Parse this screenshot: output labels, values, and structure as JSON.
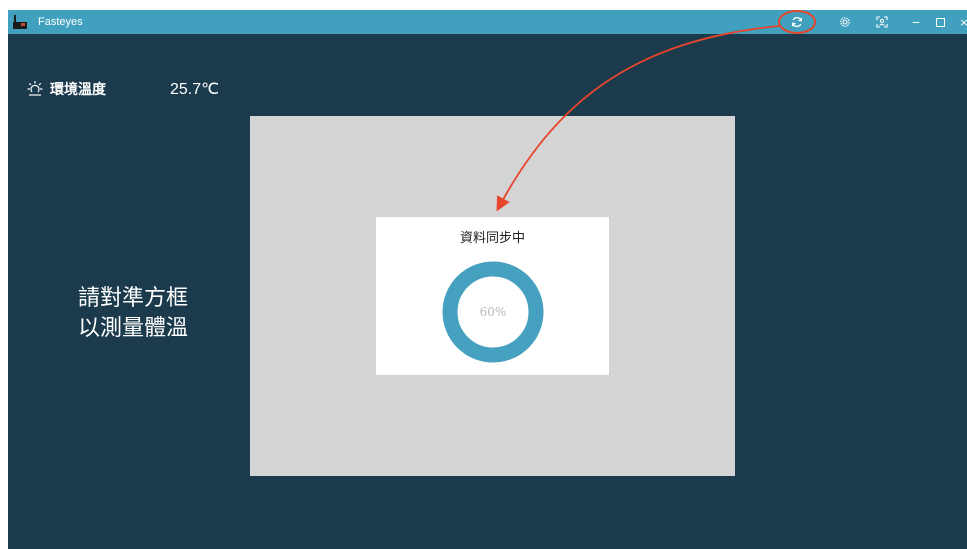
{
  "window": {
    "title": "Fasteyes",
    "icon": "camera-device-icon"
  },
  "titlebar_buttons": [
    {
      "name": "sync-button",
      "icon": "refresh-icon",
      "glyph": "⟳"
    },
    {
      "name": "settings-button",
      "icon": "gear-icon",
      "glyph": "⚙"
    },
    {
      "name": "face-frame-button",
      "icon": "face-frame-icon",
      "glyph": "⛶"
    },
    {
      "name": "minimize-button",
      "icon": "minimize-icon",
      "glyph": "−"
    },
    {
      "name": "maximize-button",
      "icon": "maximize-icon",
      "glyph": "□"
    },
    {
      "name": "close-button",
      "icon": "close-icon",
      "glyph": "×"
    }
  ],
  "environment": {
    "label": "環境溫度",
    "value": "25.7℃",
    "icon": "sun-icon"
  },
  "instruction": {
    "line1": "請對準方框",
    "line2": "以測量體溫"
  },
  "sync_dialog": {
    "title": "資料同步中",
    "progress_label": "60%",
    "progress": 0.6
  },
  "colors": {
    "background": "#1b3b4d",
    "titlebar": "#42a0bf",
    "ring": "#46a0c0",
    "camera_frame": "#d4d4d4",
    "annotation": "#e8452d"
  }
}
